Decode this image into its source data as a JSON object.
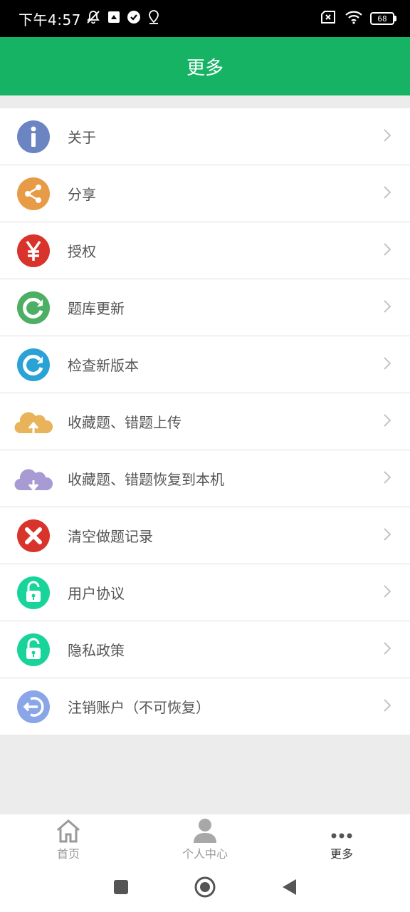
{
  "status_bar": {
    "time": "下午4:57",
    "battery_level": "68",
    "icons": [
      "mute-icon",
      "sim-icon",
      "check-circle-icon",
      "location-icon",
      "no-sim-icon",
      "wifi-icon",
      "battery-icon"
    ]
  },
  "header": {
    "title": "更多"
  },
  "menu": {
    "items": [
      {
        "label": "关于",
        "icon": "info-icon",
        "color": "#6b84c2"
      },
      {
        "label": "分享",
        "icon": "share-icon",
        "color": "#e89b46"
      },
      {
        "label": "授权",
        "icon": "yen-icon",
        "color": "#d9342b"
      },
      {
        "label": "题库更新",
        "icon": "refresh-icon",
        "color": "#4caf63"
      },
      {
        "label": "检查新版本",
        "icon": "refresh-icon",
        "color": "#2aa2d6"
      },
      {
        "label": "收藏题、错题上传",
        "icon": "cloud-upload-icon",
        "color": "#e8b35a"
      },
      {
        "label": "收藏题、错题恢复到本机",
        "icon": "cloud-download-icon",
        "color": "#a89ad2"
      },
      {
        "label": "清空做题记录",
        "icon": "close-circle-icon",
        "color": "#d9342b"
      },
      {
        "label": "用户协议",
        "icon": "unlock-icon",
        "color": "#18d49b"
      },
      {
        "label": "隐私政策",
        "icon": "unlock-icon",
        "color": "#18d49b"
      },
      {
        "label": "注销账户（不可恢复）",
        "icon": "logout-icon",
        "color": "#8aa6e8"
      }
    ]
  },
  "tab_bar": {
    "tabs": [
      {
        "label": "首页",
        "icon": "home-icon",
        "active": false
      },
      {
        "label": "个人中心",
        "icon": "person-icon",
        "active": false
      },
      {
        "label": "更多",
        "icon": "more-icon",
        "active": true
      }
    ]
  },
  "nav_bar": {
    "buttons": [
      "recents-button",
      "home-button",
      "back-button"
    ]
  }
}
